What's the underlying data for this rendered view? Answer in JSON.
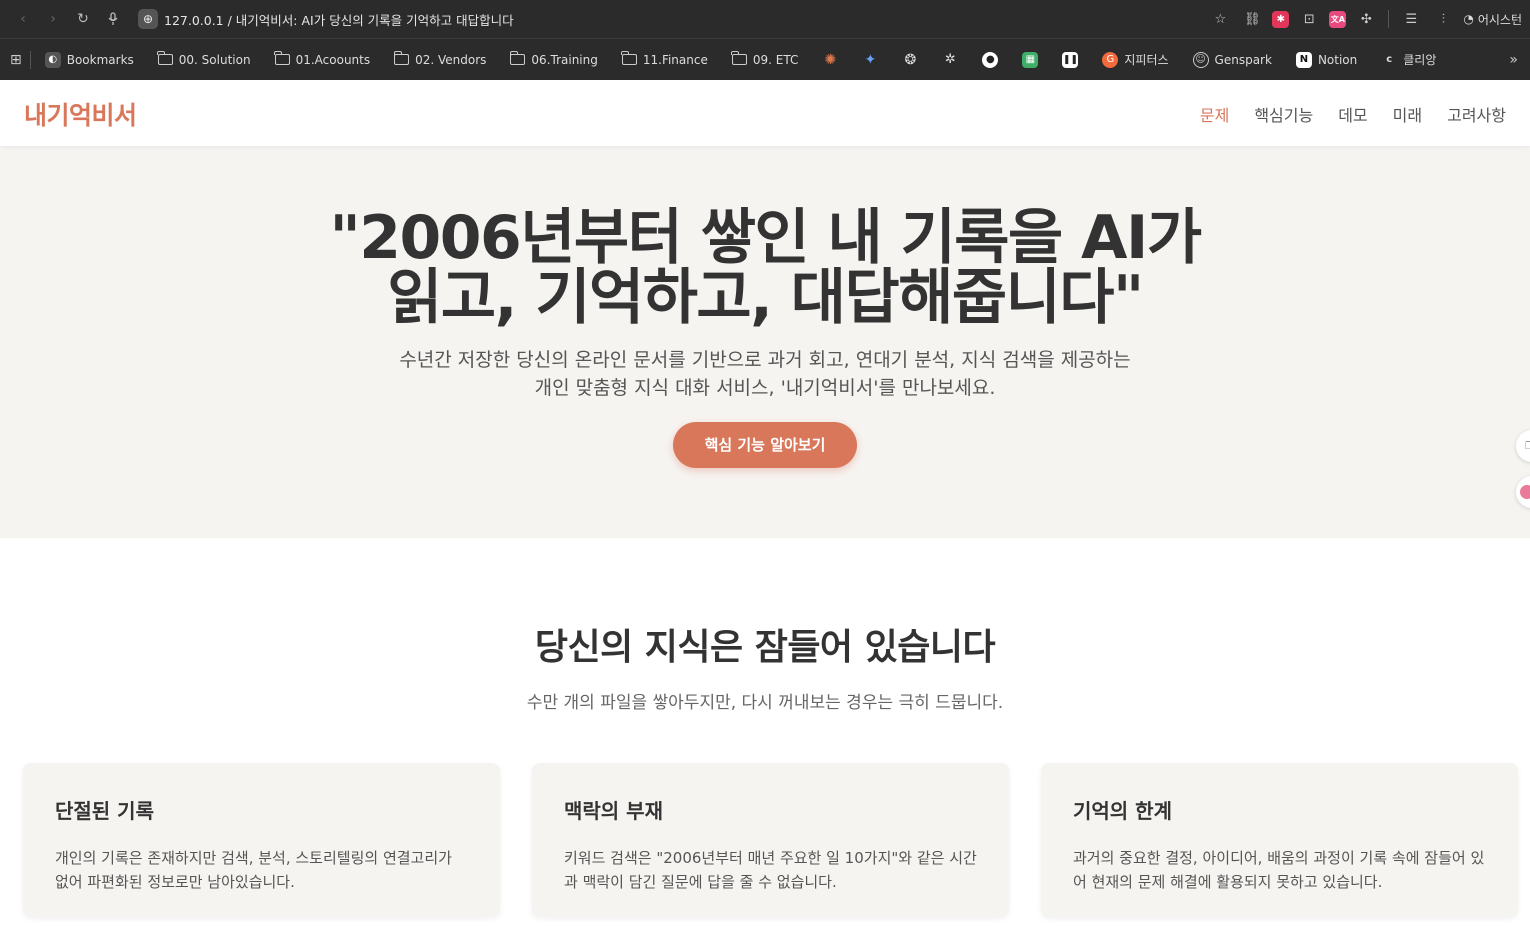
{
  "browser": {
    "url": "127.0.0.1 / 내기억비서: AI가 당신의 기록을 기억하고 대답합니다",
    "assistant_label": "어시스턴"
  },
  "bookmarks": [
    {
      "label": "Bookmarks",
      "type": "site"
    },
    {
      "label": "00. Solution",
      "type": "folder"
    },
    {
      "label": "01.Acoounts",
      "type": "folder"
    },
    {
      "label": "02. Vendors",
      "type": "folder"
    },
    {
      "label": "06.Training",
      "type": "folder"
    },
    {
      "label": "11.Finance",
      "type": "folder"
    },
    {
      "label": "09. ETC",
      "type": "folder"
    },
    {
      "label": "지피터스",
      "type": "site"
    },
    {
      "label": "Genspark",
      "type": "site"
    },
    {
      "label": "Notion",
      "type": "site"
    },
    {
      "label": "클리앙",
      "type": "site"
    }
  ],
  "site": {
    "logo": "내기억비서",
    "nav": [
      {
        "label": "문제",
        "active": true
      },
      {
        "label": "핵심기능",
        "active": false
      },
      {
        "label": "데모",
        "active": false
      },
      {
        "label": "미래",
        "active": false
      },
      {
        "label": "고려사항",
        "active": false
      }
    ]
  },
  "hero": {
    "title_line1": "\"2006년부터 쌓인 내 기록을 AI가",
    "title_line2": "읽고, 기억하고, 대답해줍니다\"",
    "sub_line1": "수년간 저장한 당신의 온라인 문서를 기반으로 과거 회고, 연대기 분석, 지식 검색을 제공하는",
    "sub_line2": "개인 맞춤형 지식 대화 서비스, '내기억비서'를 만나보세요.",
    "cta": "핵심 기능 알아보기"
  },
  "problem": {
    "title": "당신의 지식은 잠들어 있습니다",
    "subtitle": "수만 개의 파일을 쌓아두지만, 다시 꺼내보는 경우는 극히 드뭅니다.",
    "cards": [
      {
        "title": "단절된 기록",
        "text": "개인의 기록은 존재하지만 검색, 분석, 스토리텔링의 연결고리가 없어 파편화된 정보로만 남아있습니다."
      },
      {
        "title": "맥락의 부재",
        "text": "키워드 검색은 \"2006년부터 매년 주요한 일 10가지\"와 같은 시간과 맥락이 담긴 질문에 답을 줄 수 없습니다."
      },
      {
        "title": "기억의 한계",
        "text": "과거의 중요한 결정, 아이디어, 배움의 과정이 기록 속에 잠들어 있어 현재의 문제 해결에 활용되지 못하고 있습니다."
      }
    ]
  },
  "colors": {
    "accent": "#d9775b",
    "hero_bg": "#f6f4f1",
    "chrome_bg": "#2b2b2b"
  }
}
